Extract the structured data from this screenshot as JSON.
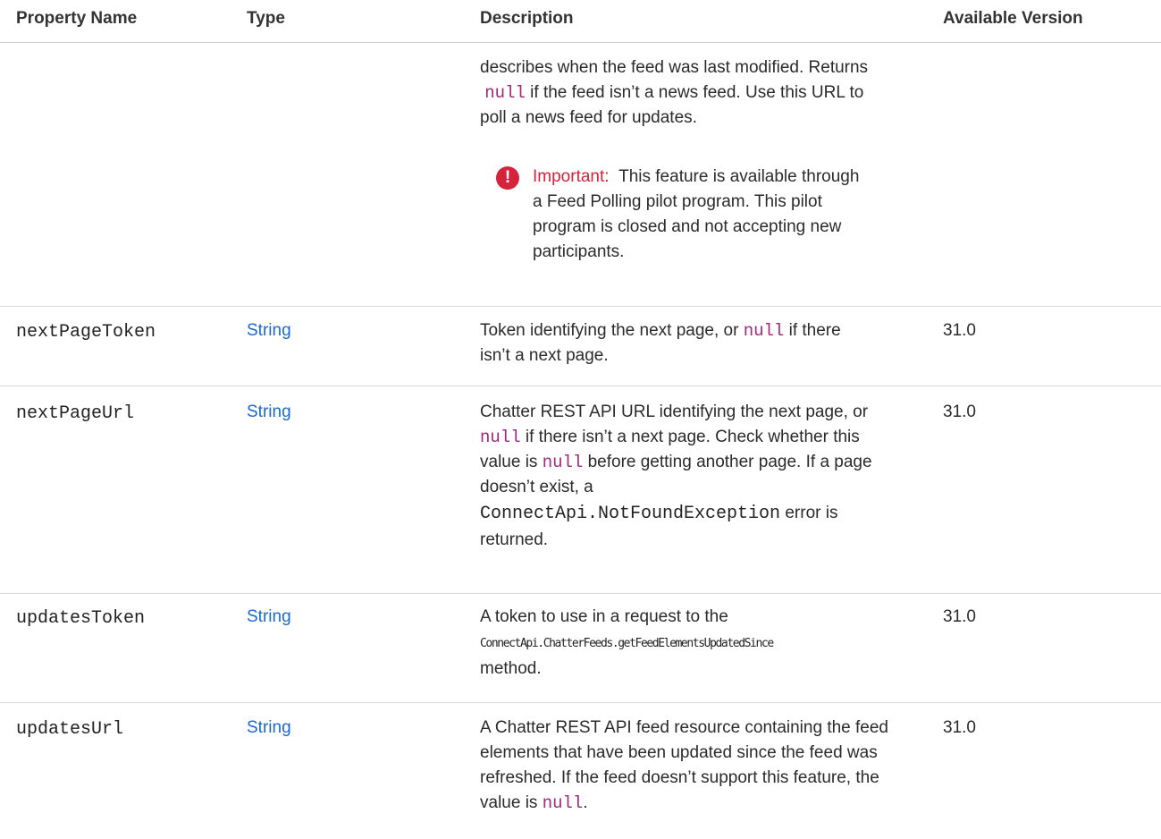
{
  "headers": {
    "property_name": "Property Name",
    "type": "Type",
    "description": "Description",
    "available_version": "Available Version"
  },
  "continued_row": {
    "desc_part1": "describes when the feed was last modified. Returns",
    "desc_null": "null",
    "desc_part2": " if the feed isn’t a news feed. Use this URL to",
    "desc_part3": "poll a news feed for updates.",
    "important_label": "Important:",
    "important_text_1": "This feature is available through",
    "important_text_2": "a Feed Polling pilot program. This pilot",
    "important_text_3": "program is closed and not accepting new",
    "important_text_4": "participants."
  },
  "rows": [
    {
      "name": "nextPageToken",
      "type": "String",
      "version": "31.0",
      "desc_l1a": "Token identifying the next page, or ",
      "desc_l1_null": "null",
      "desc_l1b": " if there",
      "desc_l2": "isn’t a next page."
    },
    {
      "name": "nextPageUrl",
      "type": "String",
      "version": "31.0",
      "desc_l1": "Chatter REST API URL identifying the next page, or",
      "desc_l2_null": "null",
      "desc_l2b": " if there isn’t a next page. Check whether this",
      "desc_l3a": "value is ",
      "desc_l3_null": "null",
      "desc_l3b": " before getting another page. If a page",
      "desc_l4": "doesn’t exist, a",
      "desc_l5_code": "ConnectApi.NotFoundException",
      "desc_l5b": " error is",
      "desc_l6": "returned."
    },
    {
      "name": "updatesToken",
      "type": "String",
      "version": "31.0",
      "desc_l1": "A token to use in a request to the",
      "desc_l2_code": "ConnectApi.ChatterFeeds.getFeedElementsUpdatedSince",
      "desc_l3": "method."
    },
    {
      "name": "updatesUrl",
      "type": "String",
      "version": "31.0",
      "desc_l1": "A Chatter REST API feed resource containing the feed",
      "desc_l2": "elements that have been updated since the feed was",
      "desc_l3": "refreshed. If the feed doesn’t support this feature, the",
      "desc_l4a": "value is ",
      "desc_l4_null": "null",
      "desc_l4b": "."
    }
  ]
}
